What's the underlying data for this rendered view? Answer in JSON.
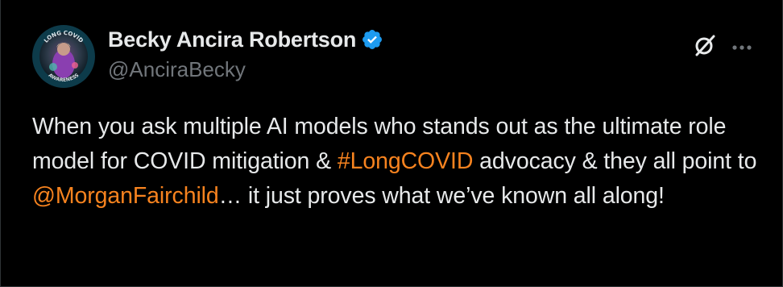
{
  "post": {
    "author": {
      "display_name": "Becky Ancira Robertson",
      "handle": "@AnciraBecky",
      "verified": true,
      "avatar_badge_top": "LONG COVID",
      "avatar_badge_bottom": "AWARENESS"
    },
    "actions": {
      "grok_icon": "grok-icon",
      "more_icon": "more-horizontal-icon"
    },
    "text": {
      "part1": "When you ask multiple AI models who stands out as the ultimate role model for COVID mitigation & ",
      "hashtag": "#LongCOVID",
      "part2": " advocacy & they all point to ",
      "mention": "@MorganFairchild",
      "part3": "… it just proves what we’ve known all along!"
    }
  },
  "colors": {
    "background": "#000000",
    "text": "#e7e9ea",
    "secondary": "#71767b",
    "link": "#f7831f",
    "verified": "#1d9bf0"
  }
}
